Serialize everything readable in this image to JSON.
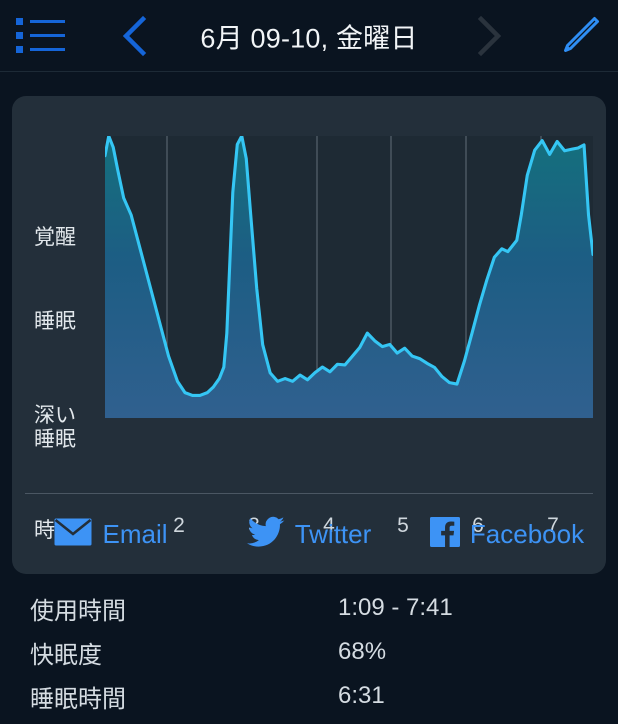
{
  "header": {
    "list_icon": "list-bullet-icon",
    "prev_icon": "chevron-left-icon",
    "next_icon": "chevron-right-icon",
    "edit_icon": "pencil-icon",
    "title": "6月 09-10, 金曜日",
    "prev_color": "#1565d8",
    "next_color": "#2a333d",
    "edit_color": "#2f8ef4"
  },
  "chart_data": {
    "type": "line",
    "title": "",
    "xlabel": "時間",
    "ylabel": "",
    "grid": true,
    "legend_position": "none",
    "y_categories": [
      "覚醒",
      "睡眠",
      "深い\n睡眠"
    ],
    "y_labels": [
      {
        "text": "覚醒",
        "value": 1.0
      },
      {
        "text": "睡眠",
        "value": 0.67
      },
      {
        "text": "深い",
        "value": 0.33
      },
      {
        "text": "睡眠",
        "value": 0.28
      }
    ],
    "xticks": [
      "2",
      "3",
      "4",
      "5",
      "6",
      "7"
    ],
    "xlim": [
      1.15,
      7.68
    ],
    "ylim": [
      0,
      1
    ],
    "line_color": "#35c6f4",
    "fill_top_color": "#136a76",
    "fill_bottom_color": "#2f5f8d",
    "plot_bg": "#1e2a34",
    "grid_color": "#5d6974",
    "series": [
      {
        "name": "sleep-depth",
        "x": [
          1.15,
          1.2,
          1.26,
          1.32,
          1.4,
          1.5,
          1.62,
          1.75,
          1.88,
          2.0,
          2.12,
          2.22,
          2.32,
          2.42,
          2.52,
          2.6,
          2.68,
          2.74,
          2.78,
          2.82,
          2.86,
          2.92,
          2.98,
          3.04,
          3.1,
          3.18,
          3.26,
          3.36,
          3.46,
          3.56,
          3.66,
          3.76,
          3.86,
          3.96,
          4.06,
          4.16,
          4.26,
          4.36,
          4.46,
          4.56,
          4.66,
          4.76,
          4.86,
          4.96,
          5.06,
          5.16,
          5.26,
          5.36,
          5.46,
          5.56,
          5.66,
          5.76,
          5.86,
          5.96,
          6.06,
          6.16,
          6.26,
          6.36,
          6.46,
          6.54,
          6.6,
          6.66,
          6.72,
          6.8,
          6.9,
          7.0,
          7.1,
          7.2,
          7.3,
          7.4,
          7.48,
          7.56,
          7.62,
          7.68
        ],
        "y": [
          0.93,
          1.0,
          0.96,
          0.88,
          0.78,
          0.72,
          0.6,
          0.47,
          0.34,
          0.22,
          0.13,
          0.09,
          0.08,
          0.08,
          0.09,
          0.11,
          0.14,
          0.18,
          0.3,
          0.55,
          0.8,
          0.97,
          1.0,
          0.92,
          0.72,
          0.46,
          0.26,
          0.16,
          0.13,
          0.14,
          0.13,
          0.15,
          0.14,
          0.16,
          0.17,
          0.16,
          0.19,
          0.18,
          0.21,
          0.26,
          0.29,
          0.28,
          0.26,
          0.25,
          0.24,
          0.25,
          0.23,
          0.22,
          0.19,
          0.17,
          0.14,
          0.12,
          0.13,
          0.2,
          0.3,
          0.4,
          0.49,
          0.57,
          0.6,
          0.59,
          0.61,
          0.63,
          0.72,
          0.86,
          0.96,
          0.97,
          0.95,
          0.97,
          0.96,
          0.97,
          0.95,
          0.96,
          0.72,
          0.58
        ]
      }
    ]
  },
  "share": {
    "items": [
      {
        "label": "Email",
        "icon": "envelope-icon",
        "color": "#3d93f5"
      },
      {
        "label": "Twitter",
        "icon": "twitter-bird-icon",
        "color": "#3d93f5"
      },
      {
        "label": "Facebook",
        "icon": "facebook-icon",
        "color": "#3d93f5"
      }
    ]
  },
  "stats": {
    "rows": [
      {
        "key": "使用時間",
        "value": "1:09 - 7:41"
      },
      {
        "key": "快眠度",
        "value": "68%"
      },
      {
        "key": "睡眠時間",
        "value": "6:31"
      }
    ]
  }
}
